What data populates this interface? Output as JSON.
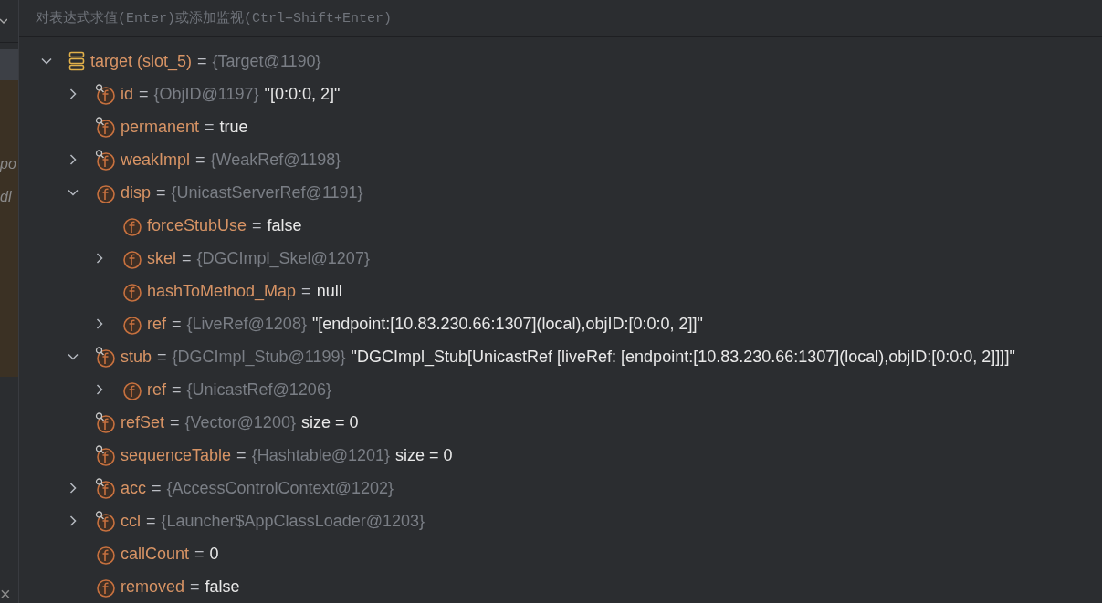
{
  "left_panel": {
    "texts": [
      "po",
      "dl"
    ],
    "close_glyph": "×"
  },
  "evaluate_field": {
    "placeholder": "对表达式求值(Enter)或添加监视(Ctrl+Shift+Enter)"
  },
  "tree": [
    {
      "kind": "local",
      "name": "target (slot_5)",
      "operator": "=",
      "type": "{Target@1190}",
      "expanded": true,
      "children": [
        {
          "kind": "field",
          "final": true,
          "name": "id",
          "operator": "=",
          "type": "{ObjID@1197}",
          "value": "\"[0:0:0, 2]\"",
          "expanded": false
        },
        {
          "kind": "field",
          "final": true,
          "name": "permanent",
          "operator": "=",
          "value": "true"
        },
        {
          "kind": "field",
          "final": true,
          "name": "weakImpl",
          "operator": "=",
          "type": "{WeakRef@1198}",
          "expanded": false
        },
        {
          "kind": "field",
          "final": false,
          "name": "disp",
          "operator": "=",
          "type": "{UnicastServerRef@1191}",
          "expanded": true,
          "children": [
            {
              "kind": "field",
              "final": false,
              "name": "forceStubUse",
              "operator": "=",
              "value": "false"
            },
            {
              "kind": "field",
              "final": false,
              "name": "skel",
              "operator": "=",
              "type": "{DGCImpl_Skel@1207}",
              "expanded": false
            },
            {
              "kind": "field",
              "final": false,
              "name": "hashToMethod_Map",
              "operator": "=",
              "value": "null"
            },
            {
              "kind": "field",
              "final": false,
              "name": "ref",
              "operator": "=",
              "type": "{LiveRef@1208}",
              "value": "\"[endpoint:[10.83.230.66:1307](local),objID:[0:0:0, 2]]\"",
              "expanded": false
            }
          ]
        },
        {
          "kind": "field",
          "final": true,
          "name": "stub",
          "operator": "=",
          "type": "{DGCImpl_Stub@1199}",
          "value": "\"DGCImpl_Stub[UnicastRef [liveRef: [endpoint:[10.83.230.66:1307](local),objID:[0:0:0, 2]]]]\"",
          "expanded": true,
          "children": [
            {
              "kind": "field",
              "final": false,
              "name": "ref",
              "operator": "=",
              "type": "{UnicastRef@1206}",
              "expanded": false
            }
          ]
        },
        {
          "kind": "field",
          "final": true,
          "name": "refSet",
          "operator": "=",
          "type": "{Vector@1200}",
          "value": "size = 0"
        },
        {
          "kind": "field",
          "final": true,
          "name": "sequenceTable",
          "operator": "=",
          "type": "{Hashtable@1201}",
          "value": "size = 0"
        },
        {
          "kind": "field",
          "final": true,
          "name": "acc",
          "operator": "=",
          "type": "{AccessControlContext@1202}",
          "expanded": false
        },
        {
          "kind": "field",
          "final": true,
          "name": "ccl",
          "operator": "=",
          "type": "{Launcher$AppClassLoader@1203}",
          "expanded": false
        },
        {
          "kind": "field",
          "final": false,
          "name": "callCount",
          "operator": "=",
          "value": "0"
        },
        {
          "kind": "field",
          "final": false,
          "name": "removed",
          "operator": "=",
          "value": "false"
        }
      ]
    }
  ]
}
